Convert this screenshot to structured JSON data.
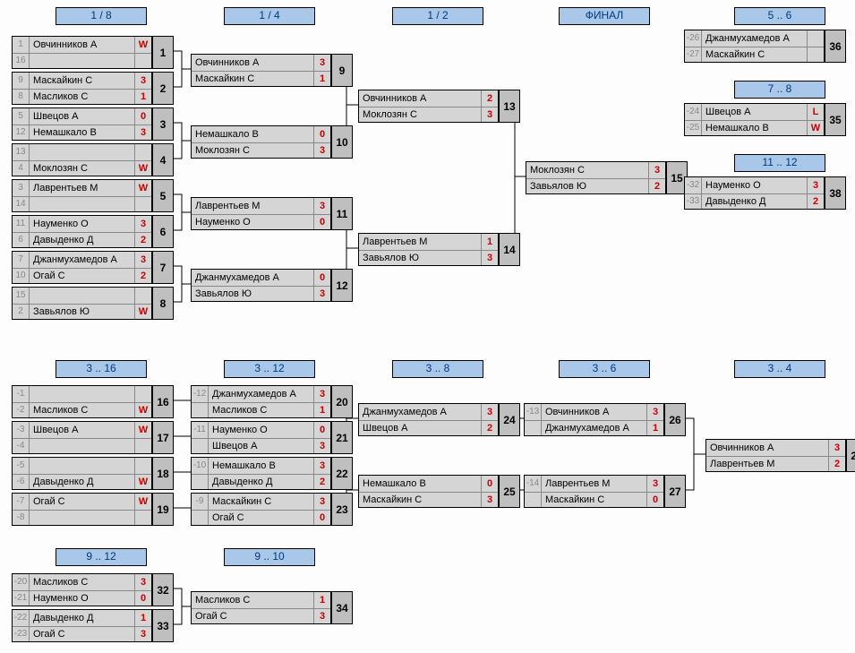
{
  "headers": {
    "h18": "1 / 8",
    "h14": "1 / 4",
    "h12": "1 / 2",
    "hfin": "ФИНАЛ",
    "h56": "5 .. 6",
    "h78": "7 .. 8",
    "h1112": "11 .. 12",
    "h316": "3 .. 16",
    "h312": "3 .. 12",
    "h38": "3 .. 8",
    "h36": "3 .. 6",
    "h34": "3 .. 4",
    "h912": "9 .. 12",
    "h910": "9 .. 10"
  },
  "m": {
    "1": {
      "s1": "1",
      "n1": "Овчинников А",
      "c1": "W",
      "s2": "16",
      "n2": "",
      "c2": ""
    },
    "2": {
      "s1": "9",
      "n1": "Маскайкин С",
      "c1": "3",
      "s2": "8",
      "n2": "Масликов С",
      "c2": "1"
    },
    "3": {
      "s1": "5",
      "n1": "Швецов А",
      "c1": "0",
      "s2": "12",
      "n2": "Немашкало В",
      "c2": "3"
    },
    "4": {
      "s1": "13",
      "n1": "",
      "c1": "",
      "s2": "4",
      "n2": "Моклозян С",
      "c2": "W"
    },
    "5": {
      "s1": "3",
      "n1": "Лаврентьев М",
      "c1": "W",
      "s2": "14",
      "n2": "",
      "c2": ""
    },
    "6": {
      "s1": "11",
      "n1": "Науменко О",
      "c1": "3",
      "s2": "6",
      "n2": "Давыденко Д",
      "c2": "2"
    },
    "7": {
      "s1": "7",
      "n1": "Джанмухамедов А",
      "c1": "3",
      "s2": "10",
      "n2": "Огай С",
      "c2": "2"
    },
    "8": {
      "s1": "15",
      "n1": "",
      "c1": "",
      "s2": "2",
      "n2": "Завьялов Ю",
      "c2": "W"
    },
    "9": {
      "n1": "Овчинников А",
      "c1": "3",
      "n2": "Маскайкин С",
      "c2": "1"
    },
    "10": {
      "n1": "Немашкало В",
      "c1": "0",
      "n2": "Моклозян С",
      "c2": "3"
    },
    "11": {
      "n1": "Лаврентьев М",
      "c1": "3",
      "n2": "Науменко О",
      "c2": "0"
    },
    "12": {
      "n1": "Джанмухамедов А",
      "c1": "0",
      "n2": "Завьялов Ю",
      "c2": "3"
    },
    "13": {
      "n1": "Овчинников А",
      "c1": "2",
      "n2": "Моклозян С",
      "c2": "3"
    },
    "14": {
      "n1": "Лаврентьев М",
      "c1": "1",
      "n2": "Завьялов Ю",
      "c2": "3"
    },
    "15": {
      "n1": "Моклозян С",
      "c1": "3",
      "n2": "Завьялов Ю",
      "c2": "2"
    },
    "16": {
      "s1": "-1",
      "n1": "",
      "c1": "",
      "s2": "-2",
      "n2": "Масликов С",
      "c2": "W"
    },
    "17": {
      "s1": "-3",
      "n1": "Швецов А",
      "c1": "W",
      "s2": "-4",
      "n2": "",
      "c2": ""
    },
    "18": {
      "s1": "-5",
      "n1": "",
      "c1": "",
      "s2": "-6",
      "n2": "Давыденко Д",
      "c2": "W"
    },
    "19": {
      "s1": "-7",
      "n1": "Огай С",
      "c1": "W",
      "s2": "-8",
      "n2": "",
      "c2": ""
    },
    "20": {
      "s1": "-12",
      "n1": "Джанмухамедов А",
      "c1": "3",
      "s2": "",
      "n2": "Масликов С",
      "c2": "1"
    },
    "21": {
      "s1": "-11",
      "n1": "Науменко О",
      "c1": "0",
      "s2": "",
      "n2": "Швецов А",
      "c2": "3"
    },
    "22": {
      "s1": "-10",
      "n1": "Немашкало В",
      "c1": "3",
      "s2": "",
      "n2": "Давыденко Д",
      "c2": "2"
    },
    "23": {
      "s1": "-9",
      "n1": "Маскайкин С",
      "c1": "3",
      "s2": "",
      "n2": "Огай С",
      "c2": "0"
    },
    "24": {
      "n1": "Джанмухамедов А",
      "c1": "3",
      "n2": "Швецов А",
      "c2": "2"
    },
    "25": {
      "n1": "Немашкало В",
      "c1": "0",
      "n2": "Маскайкин С",
      "c2": "3"
    },
    "26": {
      "s1": "-13",
      "n1": "Овчинников А",
      "c1": "3",
      "s2": "",
      "n2": "Джанмухамедов А",
      "c2": "1"
    },
    "27": {
      "s1": "-14",
      "n1": "Лаврентьев М",
      "c1": "3",
      "s2": "",
      "n2": "Маскайкин С",
      "c2": "0"
    },
    "28": {
      "n1": "Овчинников А",
      "c1": "3",
      "n2": "Лаврентьев М",
      "c2": "2"
    },
    "32": {
      "s1": "-20",
      "n1": "Масликов С",
      "c1": "3",
      "s2": "-21",
      "n2": "Науменко О",
      "c2": "0"
    },
    "33": {
      "s1": "-22",
      "n1": "Давыденко Д",
      "c1": "1",
      "s2": "-23",
      "n2": "Огай С",
      "c2": "3"
    },
    "34": {
      "n1": "Масликов С",
      "c1": "1",
      "n2": "Огай С",
      "c2": "3"
    },
    "35": {
      "s1": "-24",
      "n1": "Швецов А",
      "c1": "L",
      "s2": "-25",
      "n2": "Немашкало В",
      "c2": "W"
    },
    "36": {
      "s1": "-26",
      "n1": "Джанмухамедов А",
      "c1": "",
      "s2": "-27",
      "n2": "Маскайкин С",
      "c2": ""
    },
    "38": {
      "s1": "-32",
      "n1": "Науменко О",
      "c1": "3",
      "s2": "-33",
      "n2": "Давыденко Д",
      "c2": "2"
    }
  }
}
